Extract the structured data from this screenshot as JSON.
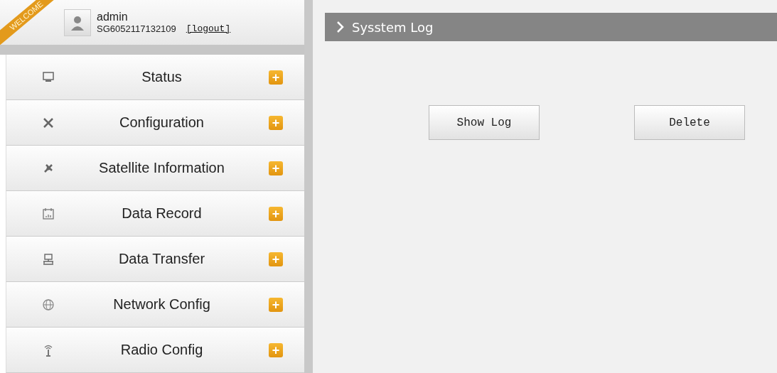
{
  "user": {
    "ribbon": "WELCOME",
    "name": "admin",
    "serial": "SG6052117132109",
    "logout": "[logout]"
  },
  "menu": [
    {
      "label": "Status",
      "expand": "+"
    },
    {
      "label": "Configuration",
      "expand": "+"
    },
    {
      "label": "Satellite Information",
      "expand": "+"
    },
    {
      "label": "Data Record",
      "expand": "+"
    },
    {
      "label": "Data Transfer",
      "expand": "+"
    },
    {
      "label": "Network Config",
      "expand": "+"
    },
    {
      "label": "Radio Config",
      "expand": "+"
    }
  ],
  "panel": {
    "title": "Sysstem Log",
    "buttons": [
      "Show Log",
      "Delete"
    ]
  }
}
